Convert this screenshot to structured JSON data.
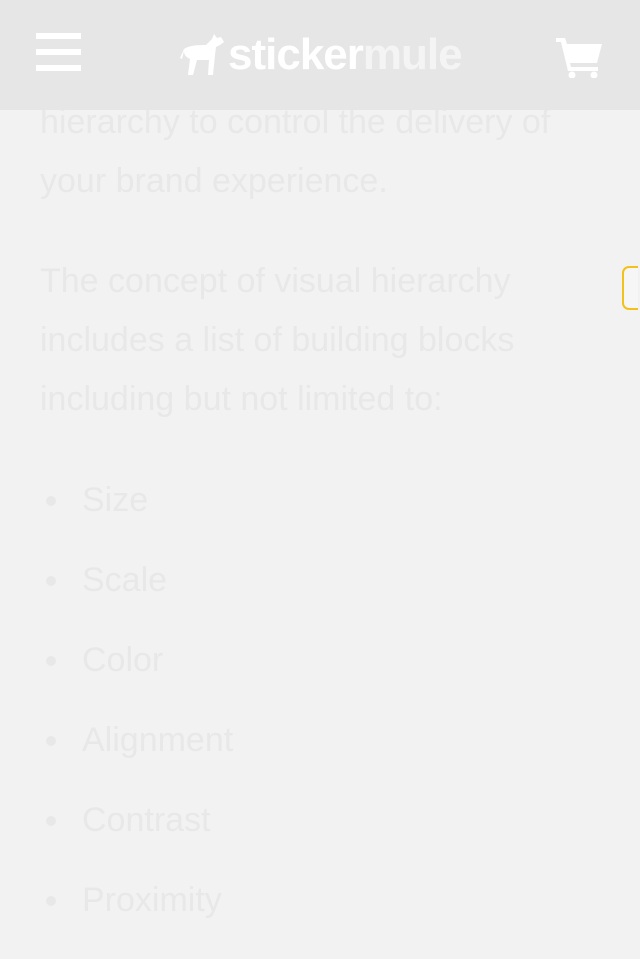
{
  "header": {
    "logo_part1": "sticker",
    "logo_part2": "mule",
    "menu_icon": "hamburger-menu-icon",
    "cart_icon": "shopping-cart-icon",
    "background_color": "#e6e6e6"
  },
  "article": {
    "paragraph1": "hierarchy to control the delivery of your brand experience.",
    "paragraph2": "The concept of visual hierarchy includes a list of building blocks including but not limited to:",
    "list_items": [
      "Size",
      "Scale",
      "Color",
      "Alignment",
      "Contrast",
      "Proximity"
    ],
    "text_color": "#e8e8e8"
  },
  "accent_color": "#f2c21a"
}
